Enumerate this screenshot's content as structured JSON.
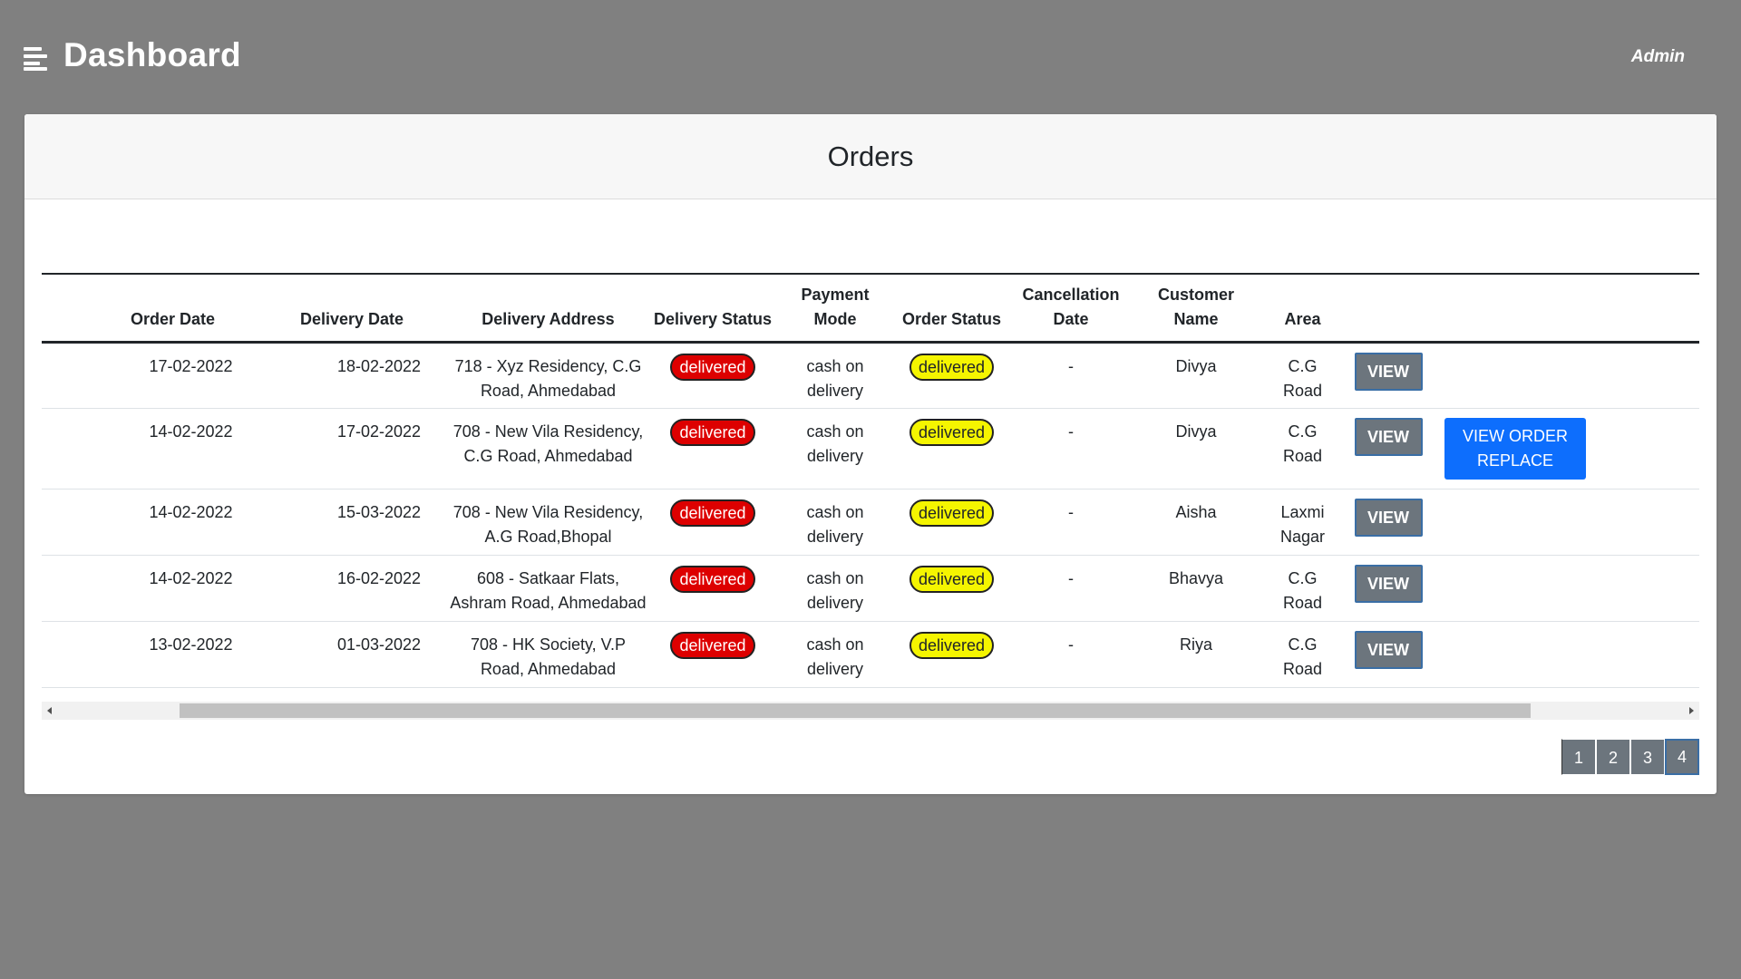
{
  "header": {
    "title": "Dashboard",
    "user": "Admin"
  },
  "card": {
    "title": "Orders"
  },
  "table": {
    "columns": [
      "",
      "Order Date",
      "Delivery Date",
      "Delivery Address",
      "Delivery Status",
      "Payment Mode",
      "Order Status",
      "Cancellation Date",
      "Customer Name",
      "Area",
      "",
      ""
    ],
    "rows": [
      {
        "order_date": "17-02-2022",
        "delivery_date": "18-02-2022",
        "address": "718 - Xyz Residency, C.G Road, Ahmedabad",
        "delivery_status": "delivered",
        "payment_mode": "cash on delivery",
        "order_status": "delivered",
        "cancellation_date": "-",
        "customer": "Divya",
        "area": "C.G Road",
        "view_label": "VIEW",
        "replace_label": ""
      },
      {
        "order_date": "14-02-2022",
        "delivery_date": "17-02-2022",
        "address": "708 - New Vila Residency, C.G Road, Ahmedabad",
        "delivery_status": "delivered",
        "payment_mode": "cash on delivery",
        "order_status": "delivered",
        "cancellation_date": "-",
        "customer": "Divya",
        "area": "C.G Road",
        "view_label": "VIEW",
        "replace_label": "VIEW ORDER REPLACE"
      },
      {
        "order_date": "14-02-2022",
        "delivery_date": "15-03-2022",
        "address": "708 - New Vila Residency, A.G Road,Bhopal",
        "delivery_status": "delivered",
        "payment_mode": "cash on delivery",
        "order_status": "delivered",
        "cancellation_date": "-",
        "customer": "Aisha",
        "area": "Laxmi Nagar",
        "view_label": "VIEW",
        "replace_label": ""
      },
      {
        "order_date": "14-02-2022",
        "delivery_date": "16-02-2022",
        "address": "608 - Satkaar Flats, Ashram Road, Ahmedabad",
        "delivery_status": "delivered",
        "payment_mode": "cash on delivery",
        "order_status": "delivered",
        "cancellation_date": "-",
        "customer": "Bhavya",
        "area": "C.G Road",
        "view_label": "VIEW",
        "replace_label": ""
      },
      {
        "order_date": "13-02-2022",
        "delivery_date": "01-03-2022",
        "address": "708 - HK Society, V.P Road, Ahmedabad",
        "delivery_status": "delivered",
        "payment_mode": "cash on delivery",
        "order_status": "delivered",
        "cancellation_date": "-",
        "customer": "Riya",
        "area": "C.G Road",
        "view_label": "VIEW",
        "replace_label": ""
      }
    ]
  },
  "pagination": {
    "pages": [
      "1",
      "2",
      "3",
      "4"
    ],
    "active": "4"
  },
  "colors": {
    "page_bg": "#808080",
    "delivery_status_pill": "#dd0000",
    "order_status_pill": "#f5f500",
    "view_button": "#6c757d",
    "replace_button": "#0d6efd"
  },
  "icons": {
    "menu": "hamburger-menu-icon"
  }
}
